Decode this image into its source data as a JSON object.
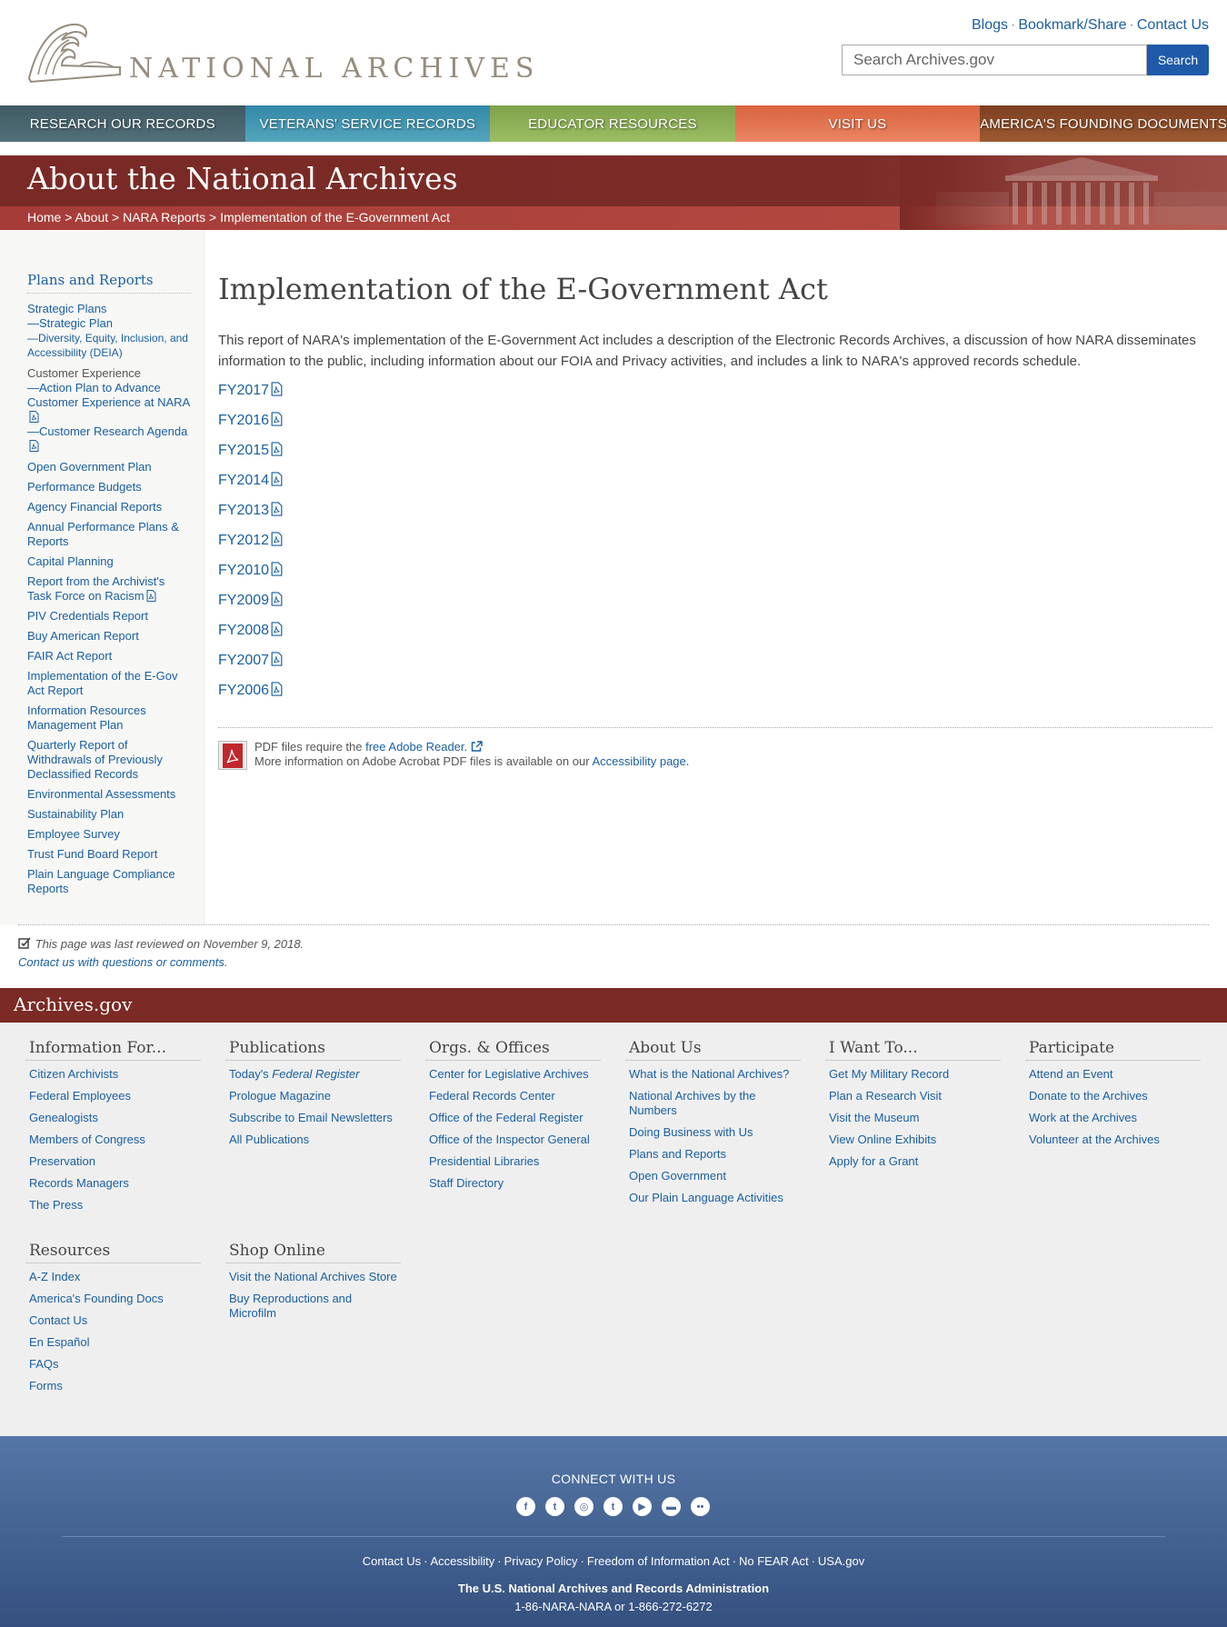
{
  "header": {
    "logo_text": "NATIONAL ARCHIVES",
    "utility_links": [
      "Blogs",
      "Bookmark/Share",
      "Contact Us"
    ],
    "search": {
      "placeholder": "Search Archives.gov",
      "button_label": "Search"
    }
  },
  "nav": [
    "RESEARCH OUR RECORDS",
    "VETERANS' SERVICE RECORDS",
    "EDUCATOR RESOURCES",
    "VISIT US",
    "AMERICA'S FOUNDING DOCUMENTS"
  ],
  "banner": {
    "title": "About the National Archives",
    "breadcrumb": [
      "Home",
      "About",
      "NARA Reports",
      "Implementation of the E-Government Act"
    ],
    "crumb_sep": " > "
  },
  "sidebar": {
    "title": "Plans and Reports",
    "strategic_plans": "Strategic Plans",
    "strategic_plan": "—Strategic Plan",
    "deia": "—Diversity, Equity, Inclusion, and Accessibility (DEIA)",
    "customer_experience": "Customer Experience",
    "action_plan": "—Action Plan to Advance Customer Experience at NARA",
    "research_agenda": "—Customer Research Agenda",
    "items_a": [
      "Open Government Plan",
      "Performance Budgets",
      "Agency Financial Reports",
      "Annual Performance Plans & Reports",
      "Capital Planning"
    ],
    "task_force": "Report from the Archivist's Task Force on Racism",
    "items_b": [
      "PIV Credentials Report",
      "Buy American Report",
      "FAIR Act Report",
      "Implementation of the E-Gov Act Report",
      "Information Resources Management Plan",
      "Quarterly Report of Withdrawals of Previously Declassified Records",
      "Environmental Assessments",
      "Sustainability Plan",
      "Employee Survey",
      "Trust Fund Board Report",
      "Plain Language Compliance Reports"
    ]
  },
  "main": {
    "heading": "Implementation of the E-Government Act",
    "intro": "This report of NARA's implementation of the E-Government Act includes a description of the Electronic Records Archives, a discussion of how NARA disseminates information to the public, including information about our FOIA and Privacy activities, and includes a link to NARA's approved records schedule.",
    "reports": [
      "FY2017",
      "FY2016",
      "FY2015",
      "FY2014",
      "FY2013",
      "FY2012",
      "FY2010",
      "FY2009",
      "FY2008",
      "FY2007",
      "FY2006"
    ],
    "pdf_note": {
      "prefix": "PDF files require the ",
      "reader_link": "free Adobe Reader.",
      "line2_prefix": "More information on Adobe Acrobat PDF files is available on our ",
      "accessibility_link": "Accessibility page",
      "line2_suffix": "."
    }
  },
  "review": {
    "last_reviewed": "This page was last reviewed on November 9, 2018.",
    "contact": "Contact us with questions or comments."
  },
  "footer": {
    "site_name": "Archives.gov",
    "columns": [
      {
        "title": "Information For...",
        "links": [
          "Citizen Archivists",
          "Federal Employees",
          "Genealogists",
          "Members of Congress",
          "Preservation",
          "Records Managers",
          "The Press"
        ]
      },
      {
        "title": "Publications",
        "links": [
          "Prologue Magazine",
          "Subscribe to Email Newsletters",
          "All Publications"
        ],
        "first_prefix": "Today's ",
        "first_italic": "Federal Register"
      },
      {
        "title": "Orgs. & Offices",
        "links": [
          "Center for Legislative Archives",
          "Federal Records Center",
          "Office of the Federal Register",
          "Office of the Inspector General",
          "Presidential Libraries",
          "Staff Directory"
        ]
      },
      {
        "title": "About Us",
        "links": [
          "What is the National Archives?",
          "National Archives by the Numbers",
          "Doing Business with Us",
          "Plans and Reports",
          "Open Government",
          "Our Plain Language Activities"
        ]
      },
      {
        "title": "I Want To...",
        "links": [
          "Get My Military Record",
          "Plan a Research Visit",
          "Visit the Museum",
          "View Online Exhibits",
          "Apply for a Grant"
        ]
      },
      {
        "title": "Participate",
        "links": [
          "Attend an Event",
          "Donate to the Archives",
          "Work at the Archives",
          "Volunteer at the Archives"
        ]
      },
      {
        "title": "Resources",
        "links": [
          "A-Z Index",
          "America's Founding Docs",
          "Contact Us",
          "En Español",
          "FAQs",
          "Forms"
        ]
      },
      {
        "title": "Shop Online",
        "links": [
          "Visit the National Archives Store",
          "Buy Reproductions and Microfilm"
        ]
      }
    ],
    "connect_title": "CONNECT WITH US",
    "social_icons": [
      "facebook-icon",
      "twitter-icon",
      "instagram-icon",
      "tumblr-icon",
      "youtube-icon",
      "blog-icon",
      "flickr-icon"
    ],
    "bottom_links": [
      "Contact Us",
      "Accessibility",
      "Privacy Policy",
      "Freedom of Information Act",
      "No FEAR Act",
      "USA.gov"
    ],
    "agency": "The U.S. National Archives and Records Administration",
    "phone": "1-86-NARA-NARA or 1-866-272-6272"
  },
  "colors": {
    "link": "#1a5fa0",
    "banner": "#7b2a25",
    "search_button": "#1e5aa8",
    "footer_blue": "#3f5e8f"
  }
}
